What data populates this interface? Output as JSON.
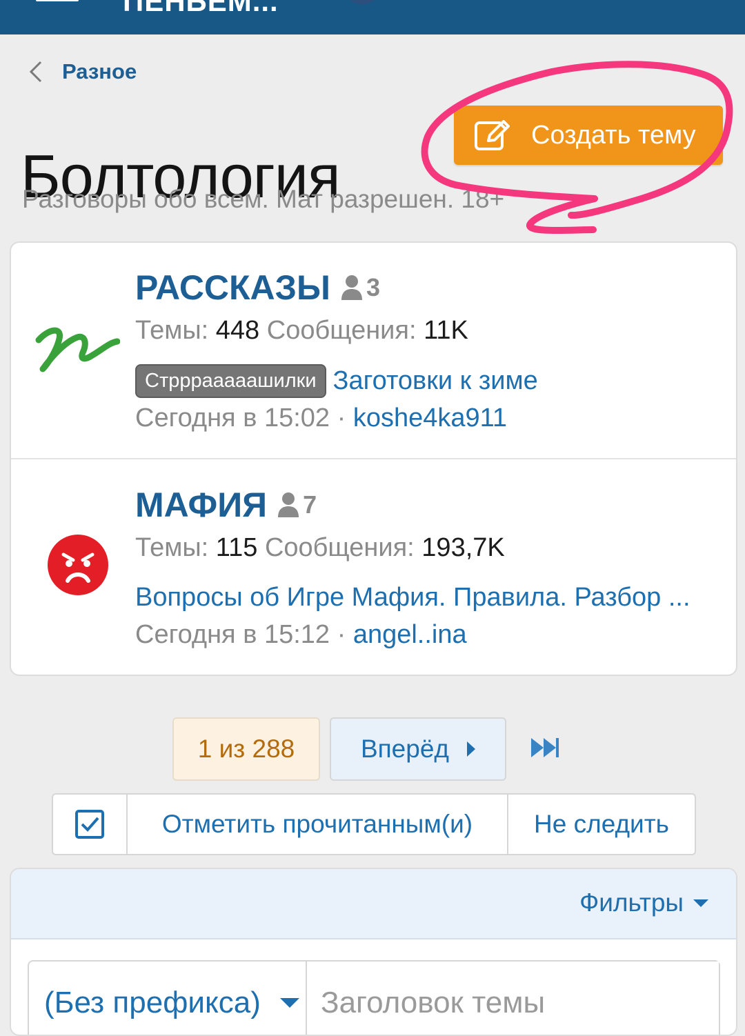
{
  "colors": {
    "header_bg": "#185886",
    "accent_blue": "#1d5f94",
    "link_blue": "#1d6fb0",
    "create_button": "#f0941a",
    "annotation_pink": "#f5377e",
    "node1_icon": "#3aa23a",
    "node2_icon": "#e41e26"
  },
  "header": {
    "logo_text_partial": "ПЕНЬЕМ..."
  },
  "breadcrumb": {
    "label": "Разное",
    "icon": "chevron-left-icon"
  },
  "page": {
    "title": "Болтология",
    "description": "Разговоры обо всем. Мат разрешен. 18+"
  },
  "create_button": {
    "label": "Создать тему",
    "icon": "edit-icon"
  },
  "nodes": [
    {
      "title": "РАССКАЗЫ",
      "users": "3",
      "threads_label": "Темы:",
      "threads": "448",
      "messages_label": "Сообщения:",
      "messages": "11K",
      "prefix": "Стрррааааашилки",
      "latest_thread": "Заготовки к зиме",
      "time": "Сегодня в 15:02",
      "separator": "·",
      "user": "koshe4ka911",
      "icon": "green-scribble-icon"
    },
    {
      "title": "МАФИЯ",
      "users": "7",
      "threads_label": "Темы:",
      "threads": "115",
      "messages_label": "Сообщения:",
      "messages": "193,7K",
      "latest_thread": "Вопросы об Игре Мафия. Правила. Разбор ...",
      "time": "Сегодня в 15:12",
      "separator": "·",
      "user": "angel..ina",
      "icon": "angry-face-icon"
    }
  ],
  "pagination": {
    "current": "1 из 288",
    "next": "Вперёд",
    "last_icon": "fast-forward-icon"
  },
  "actions": {
    "mark_read": "Отметить прочитанным(и)",
    "unwatch": "Не следить",
    "select_icon": "checkbox-icon"
  },
  "filters": {
    "label": "Фильтры",
    "prefix_value": "(Без префикса)",
    "title_placeholder": "Заголовок темы"
  }
}
